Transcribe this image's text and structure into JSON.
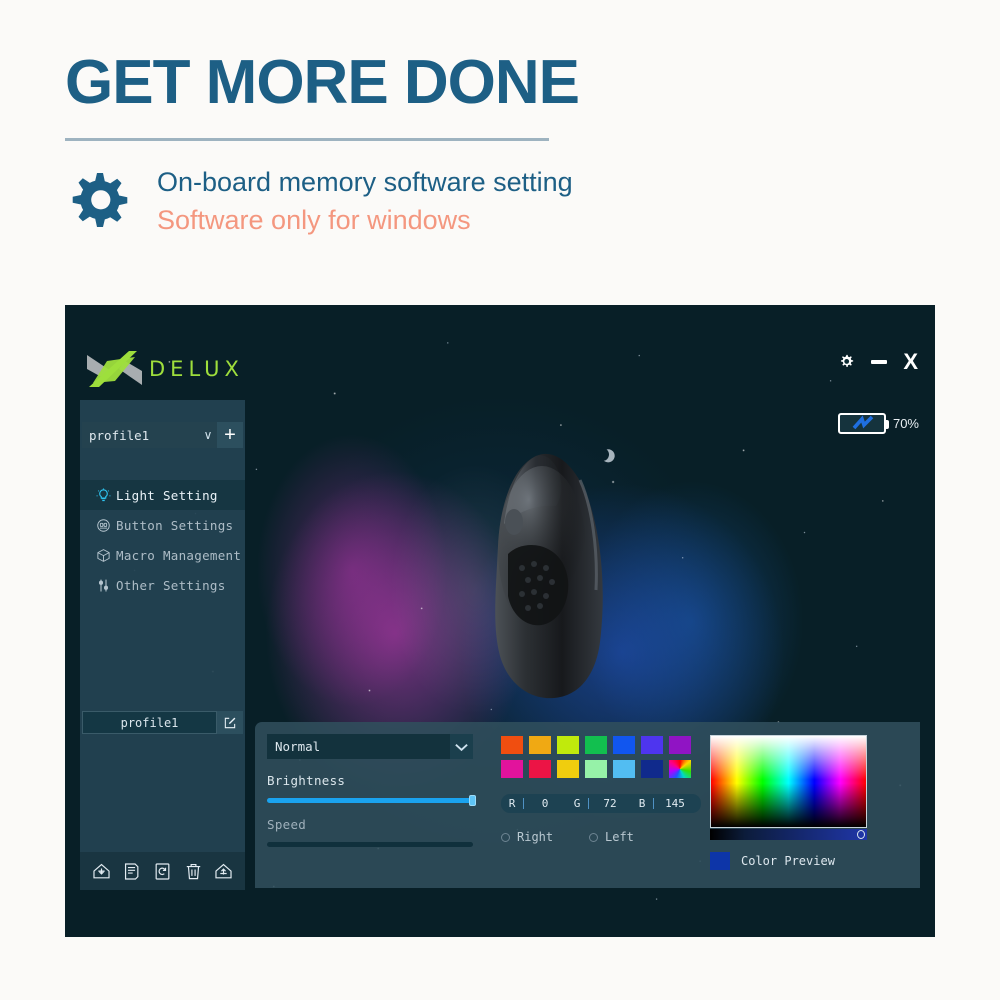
{
  "promo": {
    "title": "GET MORE DONE",
    "line1": "On-board memory software setting",
    "line2": "Software only for windows",
    "gear_icon": "gear-icon",
    "title_color": "#1d5f85",
    "accent_color": "#f4977f",
    "rule_color": "#9eb3c0"
  },
  "app": {
    "brand": "DELUX",
    "brand_color": "#9ede3c",
    "window_controls": [
      {
        "name": "settings-gear",
        "icon": "gear-icon",
        "glyph": "⚙"
      },
      {
        "name": "minimize",
        "icon": "minus-icon",
        "glyph": "–"
      },
      {
        "name": "close",
        "icon": "close-icon",
        "glyph": "X"
      }
    ],
    "battery": {
      "percent": "70%",
      "icon": "battery-charging-icon",
      "bolt_color": "#1f6fe0"
    }
  },
  "sidebar": {
    "profile_select": {
      "value": "profile1",
      "caret": "∨",
      "add_label": "+",
      "add_name": "add-profile-button"
    },
    "menu": [
      {
        "label": "Light Setting",
        "icon": "lightbulb-icon",
        "active": true
      },
      {
        "label": "Button Settings",
        "icon": "mouse-buttons-icon",
        "active": false
      },
      {
        "label": "Macro Management",
        "icon": "cube-icon",
        "active": false
      },
      {
        "label": "Other Settings",
        "icon": "sliders-icon",
        "active": false
      }
    ],
    "profile_name": "profile1",
    "edit_icon": "edit-pencil-icon",
    "toolbar": [
      {
        "name": "import-button",
        "icon": "import-tray-icon"
      },
      {
        "name": "save-button",
        "icon": "document-save-icon"
      },
      {
        "name": "refresh-button",
        "icon": "refresh-page-icon"
      },
      {
        "name": "delete-button",
        "icon": "trash-icon"
      },
      {
        "name": "export-button",
        "icon": "export-tray-icon"
      }
    ]
  },
  "light_settings": {
    "mode": {
      "value": "Normal",
      "caret": "∨"
    },
    "brightness": {
      "label": "Brightness",
      "percent": 100
    },
    "speed": {
      "label": "Speed",
      "percent": 0
    },
    "swatches": [
      "#f04e10",
      "#f0a913",
      "#c0ea0c",
      "#12bf4f",
      "#1156ef",
      "#4e35ef",
      "#9014c4",
      "#e2139c",
      "#ec1445",
      "#f0cd0e",
      "#96f2a8",
      "#52bdf2",
      "#102a8c",
      "rainbow"
    ],
    "rgb": {
      "r_label": "R",
      "r_value": "0",
      "g_label": "G",
      "g_value": "72",
      "b_label": "B",
      "b_value": "145"
    },
    "sides": [
      {
        "label": "Right",
        "selected": false
      },
      {
        "label": "Left",
        "selected": false
      }
    ],
    "color_preview": {
      "label": "Color Preview",
      "hex": "#0d35a8"
    }
  }
}
